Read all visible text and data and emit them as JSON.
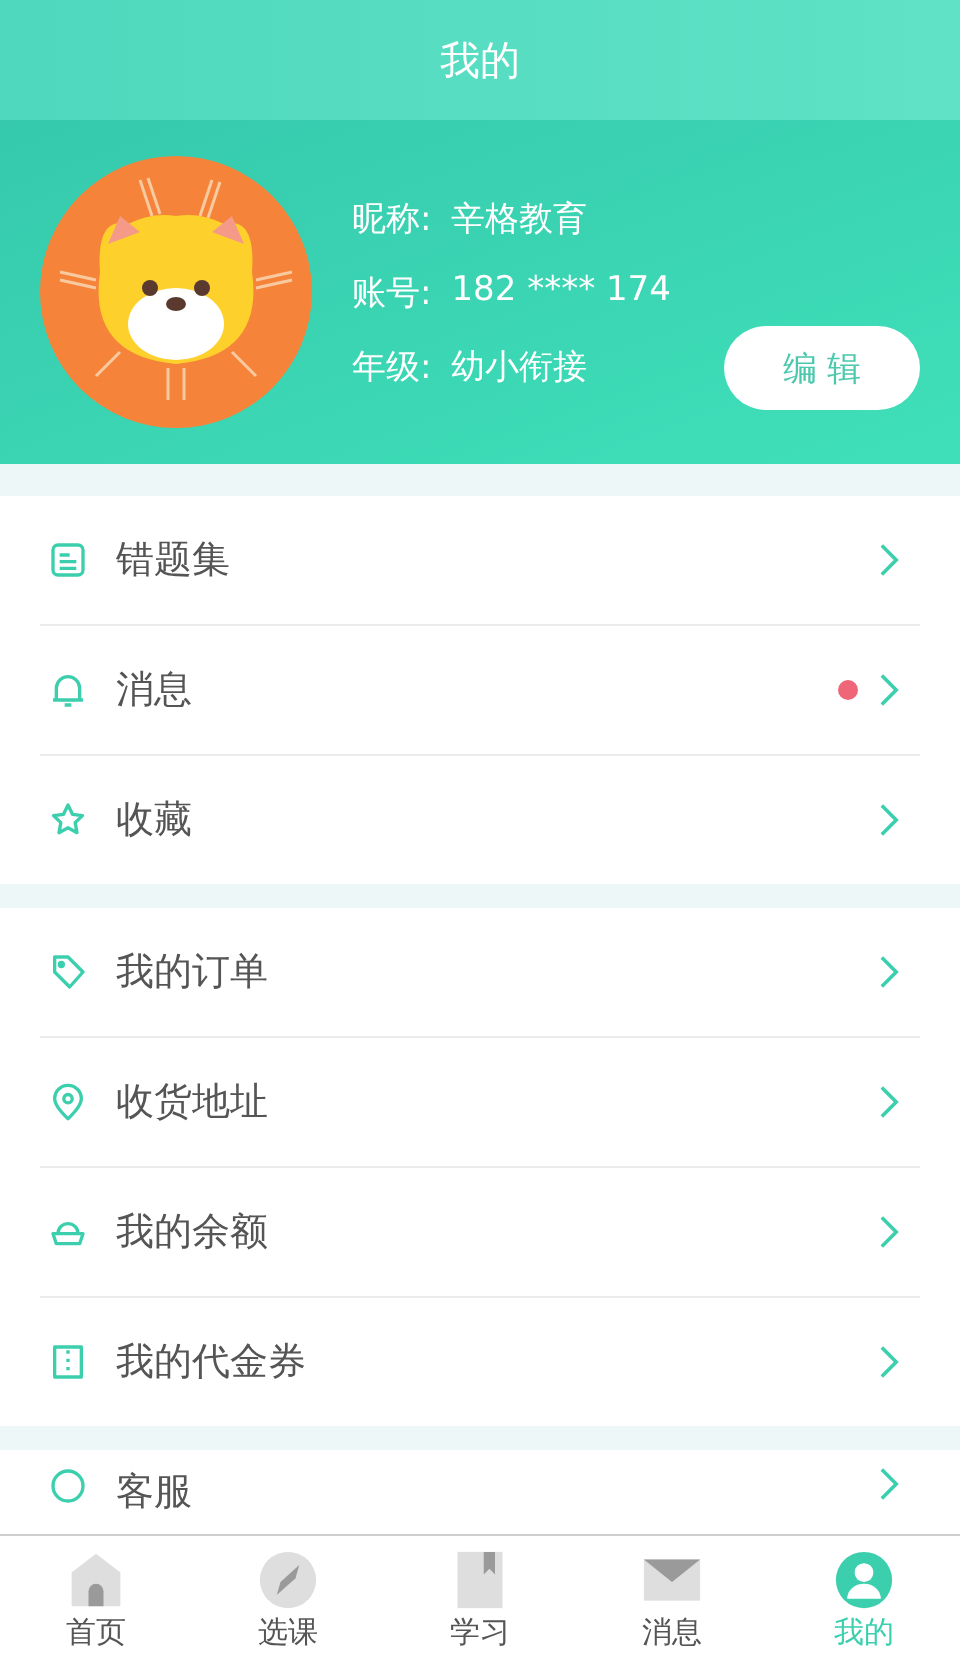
{
  "header": {
    "title": "我的"
  },
  "profile": {
    "fields": [
      {
        "label": "昵称:",
        "value": "辛格教育"
      },
      {
        "label": "账号:",
        "value": "182 **** 174"
      },
      {
        "label": "年级:",
        "value": "幼小衔接"
      }
    ],
    "edit_button": "编 辑"
  },
  "menu_groups": [
    [
      {
        "label": "错题集",
        "unread": false
      },
      {
        "label": "消息",
        "unread": true
      },
      {
        "label": "收藏",
        "unread": false
      }
    ],
    [
      {
        "label": "我的订单",
        "unread": false
      },
      {
        "label": "收货地址",
        "unread": false
      },
      {
        "label": "我的余额",
        "unread": false
      },
      {
        "label": "我的代金券",
        "unread": false
      }
    ],
    [
      {
        "label": "客服",
        "unread": false
      }
    ]
  ],
  "tabs": [
    {
      "label": "首页",
      "selected": false
    },
    {
      "label": "选课",
      "selected": false
    },
    {
      "label": "学习",
      "selected": false
    },
    {
      "label": "消息",
      "selected": false
    },
    {
      "label": "我的",
      "selected": true
    }
  ]
}
